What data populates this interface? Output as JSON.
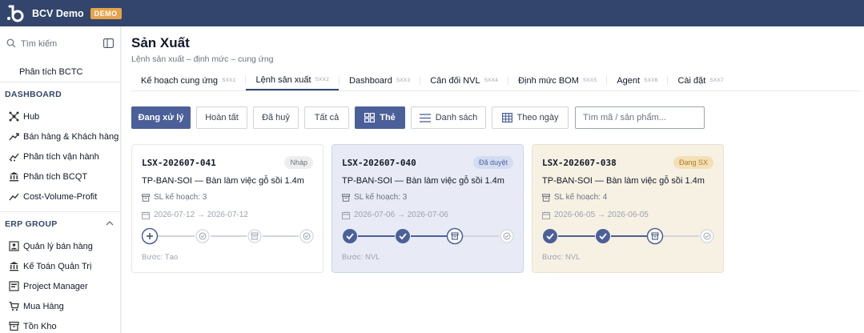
{
  "app": {
    "title": "BCV Demo",
    "badge": "DEMO"
  },
  "sidebar": {
    "search_placeholder": "Tìm kiếm",
    "pinned": "Phân tích BCTC",
    "sections": [
      {
        "title": "DASHBOARD",
        "items": [
          {
            "label": "Hub",
            "icon": "hub-icon"
          },
          {
            "label": "Bán hàng & Khách hàng",
            "icon": "trend-icon"
          },
          {
            "label": "Phân tích vận hành",
            "icon": "trend-scatter-icon"
          },
          {
            "label": "Phân tích BCQT",
            "icon": "bank-icon"
          },
          {
            "label": "Cost-Volume-Profit",
            "icon": "trend-icon"
          }
        ]
      },
      {
        "title": "ERP GROUP",
        "items": [
          {
            "label": "Quản lý bán hàng",
            "icon": "person-card-icon"
          },
          {
            "label": "Kế Toán Quản Trị",
            "icon": "bank-icon"
          },
          {
            "label": "Project Manager",
            "icon": "board-icon"
          },
          {
            "label": "Mua Hàng",
            "icon": "cart-icon"
          },
          {
            "label": "Tồn Kho",
            "icon": "archive-icon"
          }
        ]
      }
    ]
  },
  "page": {
    "title": "Sản Xuất",
    "subtitle": "Lệnh sản xuất – định mức – cung ứng"
  },
  "tabs": [
    {
      "label": "Kế hoạch cung ứng",
      "code": "SXX1"
    },
    {
      "label": "Lệnh sản xuất",
      "code": "SXX2",
      "active": true
    },
    {
      "label": "Dashboard",
      "code": "SXX3"
    },
    {
      "label": "Cân đối NVL",
      "code": "SXX4"
    },
    {
      "label": "Định mức BOM",
      "code": "SXX5"
    },
    {
      "label": "Agent",
      "code": "SXX6"
    },
    {
      "label": "Cài đặt",
      "code": "SXX7"
    }
  ],
  "filters": [
    "Đang xử lý",
    "Hoàn tất",
    "Đã huỷ",
    "Tất cả"
  ],
  "views": [
    "Thẻ",
    "Danh sách",
    "Theo ngày"
  ],
  "search_placeholder": "Tìm mã / sản phẩm...",
  "cards": [
    {
      "code": "LSX-202607-041",
      "status": "Nháp",
      "product": "TP-BAN-SOI — Bàn làm việc gỗ sồi 1.4m",
      "qty": "SL kế hoạch: 3",
      "dates": "2026-07-12 → 2026-07-12",
      "step": "Bước: Tạo",
      "progress": 0
    },
    {
      "code": "LSX-202607-040",
      "status": "Đã duyệt",
      "product": "TP-BAN-SOI — Bàn làm việc gỗ sồi 1.4m",
      "qty": "SL kế hoạch: 3",
      "dates": "2026-07-06 → 2026-07-06",
      "step": "Bước: NVL",
      "progress": 2
    },
    {
      "code": "LSX-202607-038",
      "status": "Đang SX",
      "product": "TP-BAN-SOI — Bàn làm việc gỗ sồi 1.4m",
      "qty": "SL kế hoạch: 4",
      "dates": "2026-06-05 → 2026-06-05",
      "step": "Bước: NVL",
      "progress": 2
    }
  ],
  "colors": {
    "navy": "#33456c",
    "primary": "#4b5f99",
    "demo": "#e7a34b"
  }
}
